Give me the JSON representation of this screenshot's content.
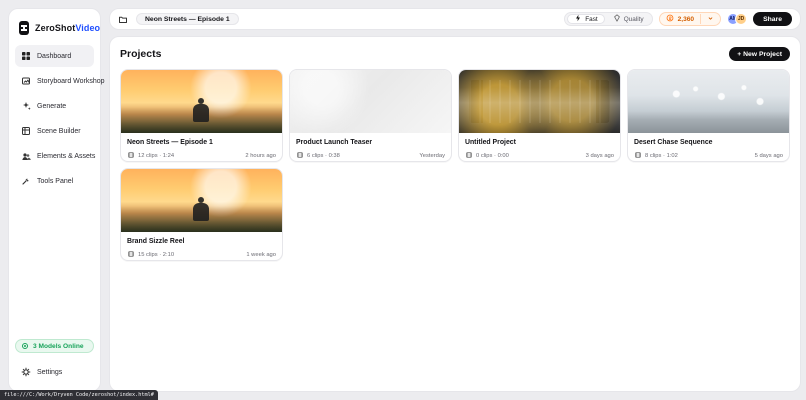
{
  "brand": {
    "name_a": "ZeroShot",
    "name_b": "Video"
  },
  "sidebar": {
    "items": [
      {
        "label": "Dashboard",
        "icon": "dashboard-icon",
        "active": true
      },
      {
        "label": "Storyboard Workshop",
        "icon": "storyboard-icon",
        "active": false
      },
      {
        "label": "Generate",
        "icon": "sparkles-icon",
        "active": false
      },
      {
        "label": "Scene Builder",
        "icon": "scene-builder-icon",
        "active": false
      },
      {
        "label": "Elements & Assets",
        "icon": "users-icon",
        "active": false
      },
      {
        "label": "Tools Panel",
        "icon": "tools-icon",
        "active": false
      }
    ],
    "models_online": "3 Models Online",
    "settings_label": "Settings"
  },
  "topbar": {
    "breadcrumb": "Neon Streets — Episode 1",
    "mode": {
      "fast": "Fast",
      "quality": "Quality"
    },
    "credits": "2,360",
    "avatars": [
      "AM",
      "JD"
    ],
    "share_label": "Share"
  },
  "main": {
    "title": "Projects",
    "new_project_label": "+ New Project",
    "projects": [
      {
        "title": "Neon Streets — Episode 1",
        "clips": "12 clips · 1:24",
        "time": "2 hours ago",
        "thumb": "neon"
      },
      {
        "title": "Product Launch Teaser",
        "clips": "6 clips · 0:38",
        "time": "Yesterday",
        "thumb": "product"
      },
      {
        "title": "Untitled Project",
        "clips": "0 clips · 0:00",
        "time": "3 days ago",
        "thumb": "untitled"
      },
      {
        "title": "Desert Chase Sequence",
        "clips": "8 clips · 1:02",
        "time": "5 days ago",
        "thumb": "desert"
      },
      {
        "title": "Brand Sizzle Reel",
        "clips": "15 clips · 2:10",
        "time": "1 week ago",
        "thumb": "neon"
      }
    ]
  },
  "statusbar": {
    "path": "file:///C:/Work/Dryven Code/zeroshot/index.html#"
  }
}
